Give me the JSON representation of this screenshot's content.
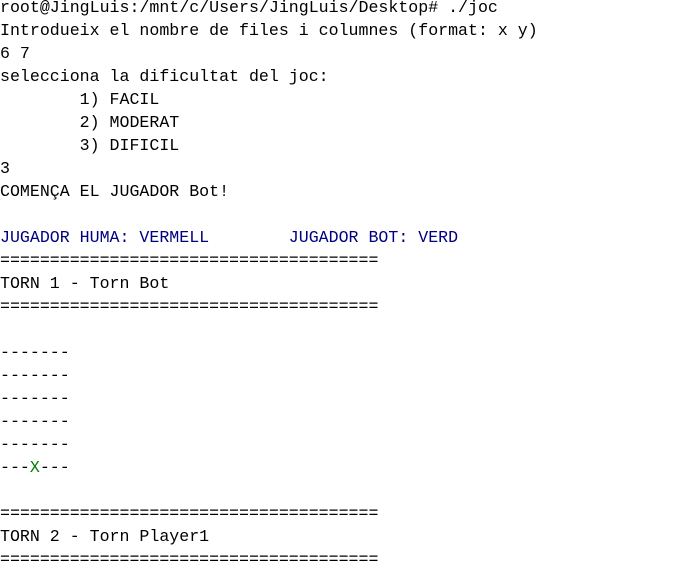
{
  "terminal": {
    "colors": {
      "default": "#000000",
      "player_info": "#000080",
      "bot_piece": "#008000",
      "background": "#ffffff"
    },
    "prompt_line": "root@JingLuis:/mnt/c/Users/JingLuis/Desktop# ./joc",
    "ask_size": "Introdueix el nombre de files i columnes (format: x y)",
    "size_input": "6 7",
    "ask_difficulty": "selecciona la dificultat del joc:",
    "options": [
      "        1) FACIL",
      "        2) MODERAT",
      "        3) DIFICIL"
    ],
    "difficulty_input": "3",
    "starter": "COMENÇA EL JUGADOR Bot!",
    "player_human": "JUGADOR HUMA: VERMELL",
    "player_gap": "        ",
    "player_bot": "JUGADOR BOT: VERD",
    "separator": "======================================",
    "turn1": "TORN 1 - Torn Bot",
    "board_rows": [
      "-------",
      "-------",
      "-------",
      "-------",
      "-------"
    ],
    "last_row": {
      "left": "---",
      "piece": "X",
      "right": "---"
    },
    "turn2": "TORN 2 - Torn Player1"
  }
}
